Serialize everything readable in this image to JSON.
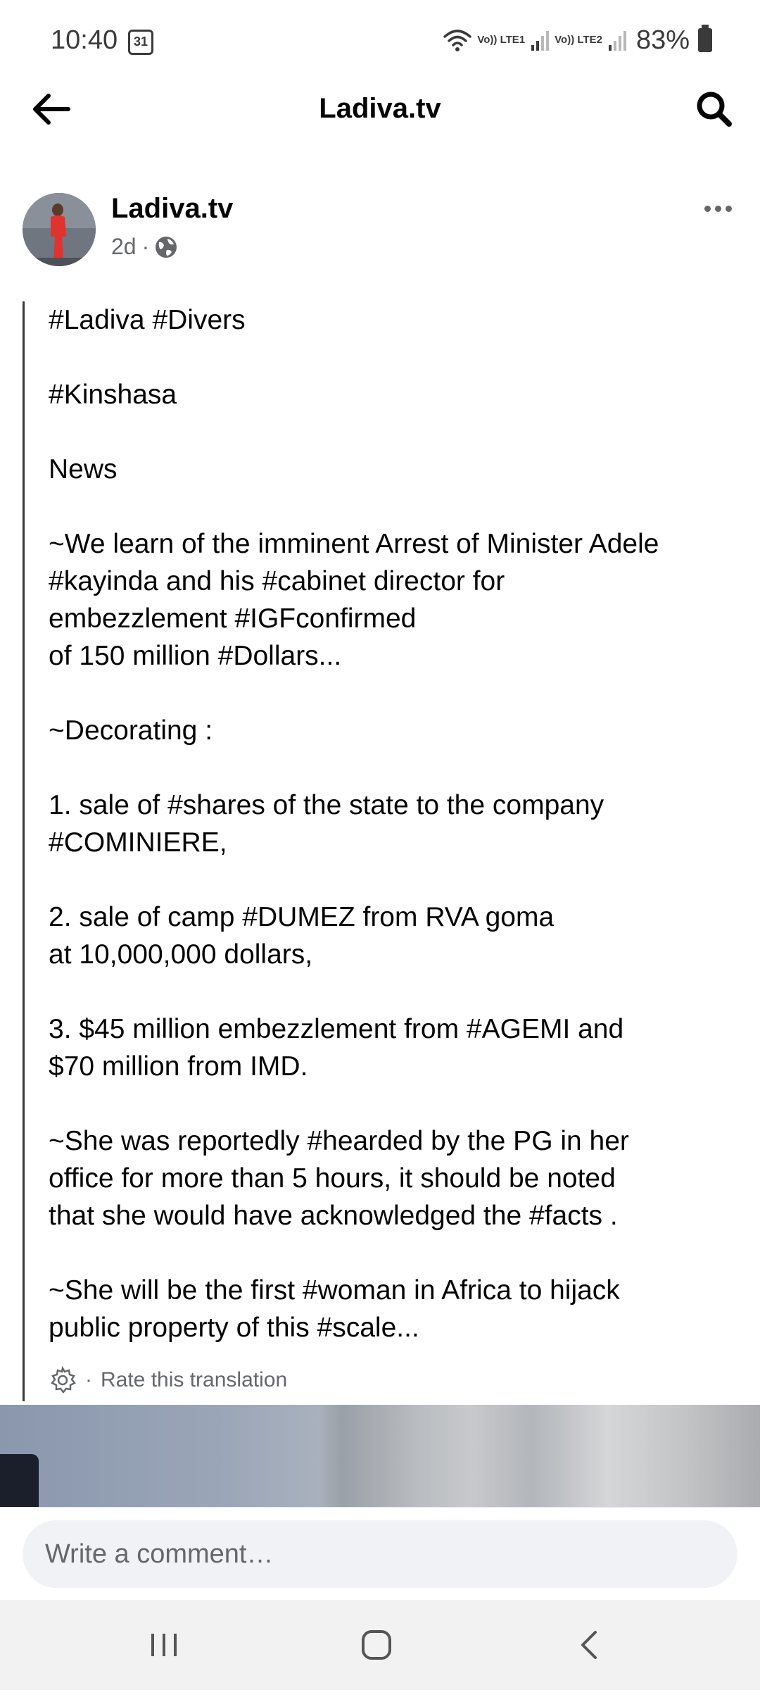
{
  "status_bar": {
    "time": "10:40",
    "calendar_day": "31",
    "sim1_label": "Vo)) LTE1",
    "sim2_label": "Vo)) LTE2",
    "battery": "83%"
  },
  "header": {
    "title": "Ladiva.tv"
  },
  "post": {
    "author": "Ladiva.tv",
    "time_ago": "2d",
    "separator": "·",
    "paragraphs": [
      "#Ladiva #Divers",
      "#Kinshasa",
      "News",
      "~We learn of the imminent Arrest of Minister Adele\n#kayinda and his #cabinet director for\nembezzlement #IGFconfirmed\nof 150 million #Dollars...",
      "~Decorating :",
      "1. sale of #shares of the state to the company\n#COMINIERE,",
      "2. sale of camp #DUMEZ from RVA goma\nat 10,000,000 dollars,",
      "3. $45 million embezzlement from #AGEMI and\n$70 million from IMD.",
      "~She was reportedly #hearded by the PG in her\noffice for more than 5 hours, it should be noted\nthat she would have acknowledged the #facts .",
      "~She will be the first #woman in Africa to hijack\npublic property of this #scale..."
    ],
    "translation_separator": "·",
    "translation_label": "Rate this translation"
  },
  "comment": {
    "placeholder": "Write a comment…"
  },
  "icons": {
    "back": "back-arrow-icon",
    "search": "search-icon",
    "more": "more-icon",
    "globe": "globe-icon",
    "settings": "gear-icon"
  }
}
